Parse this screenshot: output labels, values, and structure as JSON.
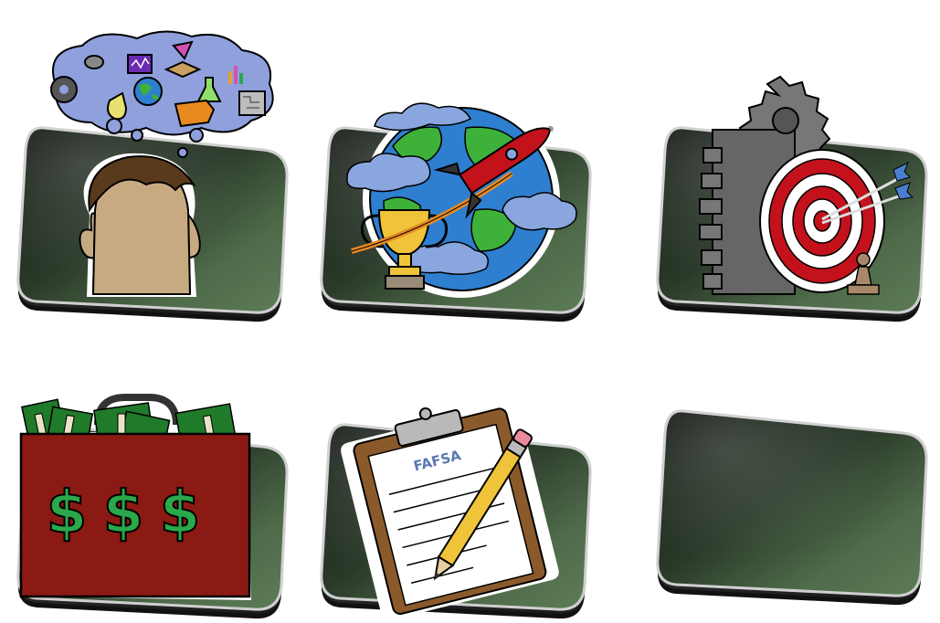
{
  "tiles": [
    {
      "id": "thinking-student",
      "icon": "thinking-head-icon"
    },
    {
      "id": "career-goals",
      "icon": "globe-rocket-trophy-icon"
    },
    {
      "id": "strategy-target",
      "icon": "gear-target-icon"
    },
    {
      "id": "money-bag",
      "icon": "money-briefcase-icon",
      "symbols": [
        "$",
        "$",
        "$"
      ]
    },
    {
      "id": "fafsa-form",
      "icon": "clipboard-pencil-icon",
      "clipboard_text": "FAFSA"
    },
    {
      "id": "empty-tile",
      "icon": ""
    }
  ],
  "colors": {
    "tile_dark": "#1d2a1d",
    "tile_green": "#5b7a54",
    "money_red": "#8b1a14",
    "dollar_green": "#2aa84a",
    "globe_blue": "#2f7fd0",
    "globe_green": "#3db13a",
    "cloud_blue": "#8aa6de",
    "target_red": "#c3121c",
    "clipboard_brown": "#8b5a2b",
    "pencil_yellow": "#f0c43a",
    "skin": "#c8aa82",
    "hair": "#5a3a1c"
  }
}
